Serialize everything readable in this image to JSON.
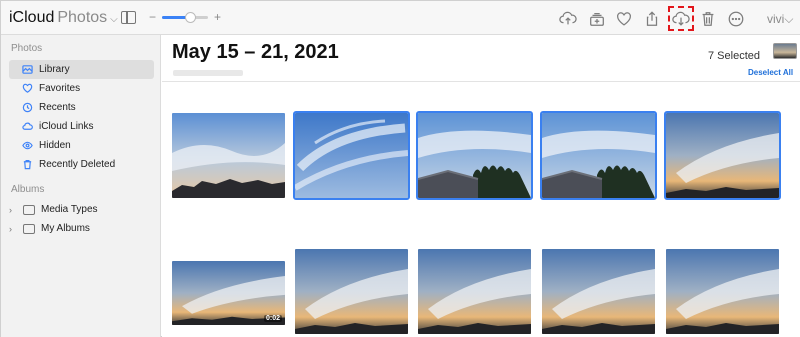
{
  "app": {
    "brand": "iCloud",
    "section": "Photos",
    "chevron": "⌵",
    "user": "vivi⌵"
  },
  "toolbar": {
    "zoom_minus": "−",
    "zoom_plus": "+",
    "zoom_level_fraction": 0.6,
    "highlight_color": "#e2161b"
  },
  "sidebar": {
    "photos_header": "Photos",
    "items": [
      {
        "label": "Library",
        "icon": "library-icon",
        "active": true
      },
      {
        "label": "Favorites",
        "icon": "heart-icon"
      },
      {
        "label": "Recents",
        "icon": "clock-icon"
      },
      {
        "label": "iCloud Links",
        "icon": "cloud-link-icon"
      },
      {
        "label": "Hidden",
        "icon": "eye-icon"
      },
      {
        "label": "Recently Deleted",
        "icon": "trash-icon"
      }
    ],
    "albums_header": "Albums",
    "groups": [
      {
        "label": "Media Types"
      },
      {
        "label": "My Albums"
      }
    ]
  },
  "main": {
    "title": "May 15 – 21, 2021",
    "selected_count": "7 Selected",
    "deselect_all": "Deselect All",
    "photos": [
      {
        "selected": false,
        "type": "sky-clouds-roofs"
      },
      {
        "selected": true,
        "type": "sky-wispy"
      },
      {
        "selected": true,
        "type": "sky-trees-roof"
      },
      {
        "selected": true,
        "type": "sky-trees-roof"
      },
      {
        "selected": true,
        "type": "sunset-clouds"
      },
      {
        "selected": false,
        "type": "sunset-video",
        "duration": "0:02"
      },
      {
        "selected": false,
        "type": "sunset-clouds"
      },
      {
        "selected": false,
        "type": "sunset-clouds"
      },
      {
        "selected": false,
        "type": "sunset-clouds"
      },
      {
        "selected": false,
        "type": "sunset-clouds"
      }
    ]
  }
}
